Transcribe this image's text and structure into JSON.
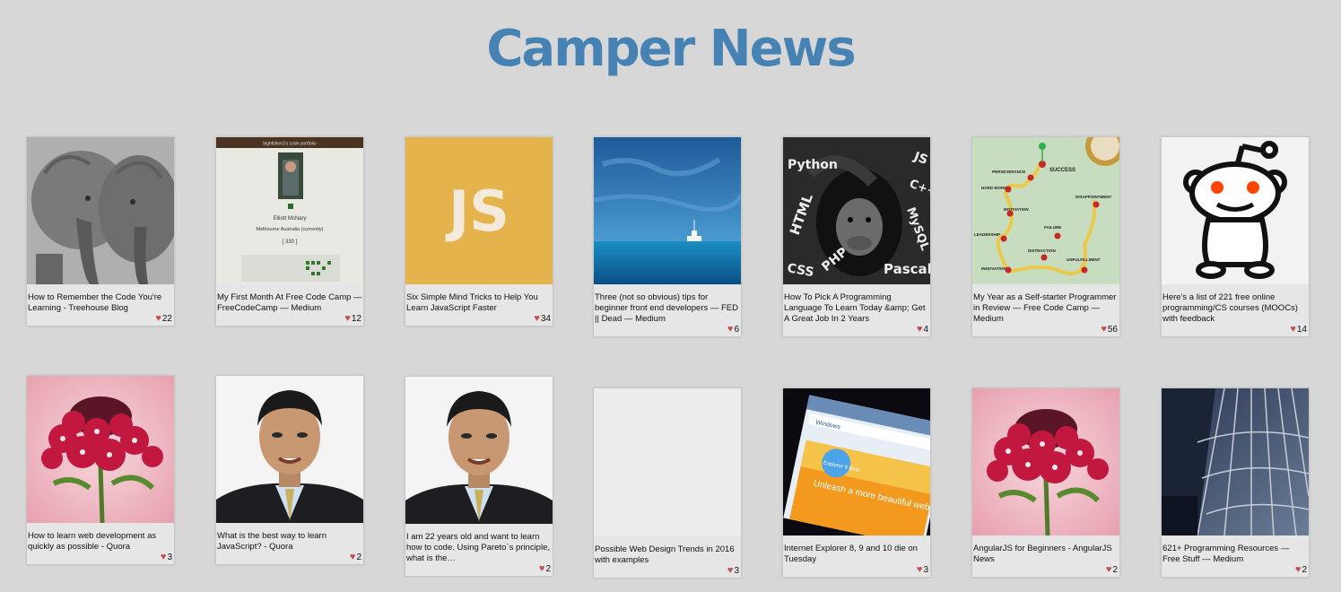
{
  "app": {
    "title": "Camper News"
  },
  "posts": [
    {
      "headline": "How to Remember the Code You're Learning - Treehouse Blog",
      "likes": "22",
      "image": "elephants-photo"
    },
    {
      "headline": "My First Month At Free Code Camp — FreeCodeCamp — Medium",
      "likes": "12",
      "image": "portfolio-screenshot",
      "portfolio": {
        "header": "bightbiker3's code portfolio",
        "name": "Elliott McNary",
        "location": "Melbourne Australia (currently)",
        "score": "[ 330 ]"
      }
    },
    {
      "headline": "Six Simple Mind Tricks to Help You Learn JavaScript Faster",
      "likes": "34",
      "image": "js-logo",
      "logo_text": "JS"
    },
    {
      "headline": "Three (not so obvious) tips for beginner front end developers — FED || Dead — Medium",
      "likes": "6",
      "image": "ocean-boat-photo"
    },
    {
      "headline": "How To Pick A Programming Language To Learn Today &amp; Get A Great Job In 2 Years",
      "likes": "4",
      "image": "chimp-languages-photo",
      "words": [
        "Python",
        "JS",
        "HTML",
        "C++",
        "MySQL",
        "CSS",
        "PHP",
        "Pascal"
      ]
    },
    {
      "headline": "My Year as a Self-starter Programmer in Review — Free Code Camp — Medium",
      "likes": "56",
      "image": "success-map",
      "map_words": [
        "SUCCESS",
        "PERSEVERANCE",
        "HARD WORK",
        "MOTIVATION",
        "LEADERSHIP",
        "FAILURE",
        "DISAPPOINTMENT",
        "DISTRACTION",
        "UNFULFILLMENT",
        "INNOVATION"
      ]
    },
    {
      "headline": "Here's a list of 221 free online programming/CS courses (MOOCs) with feedback",
      "likes": "14",
      "image": "reddit-alien"
    },
    {
      "headline": "How to learn web development as quickly as possible - Quora",
      "likes": "3",
      "image": "flower-photo"
    },
    {
      "headline": "What is the best way to learn JavaScript? - Quora",
      "likes": "2",
      "image": "portrait-photo"
    },
    {
      "headline": "I am 22 years old and want to learn how to code. Using Pareto`s principle, what is the…",
      "likes": "2",
      "image": "portrait-photo"
    },
    {
      "headline": "Possible Web Design Trends in 2016 with examples",
      "likes": "3",
      "image": "blank"
    },
    {
      "headline": "Internet Explorer 8, 9 and 10 die on Tuesday",
      "likes": "3",
      "image": "ie-screen-photo",
      "ie_text": {
        "logo": "Windows",
        "badge": "Explorer 9 Beta",
        "tagline": "Unleash a more beautiful web"
      }
    },
    {
      "headline": "AngularJS for Beginners - AngularJS News",
      "likes": "2",
      "image": "flower-photo"
    },
    {
      "headline": "621+ Programming Resources — Free Stuff — Medium",
      "likes": "2",
      "image": "building-photo"
    }
  ],
  "colors": {
    "title": "#4682b4",
    "heart": "#c0504d",
    "background": "#d7d7d7",
    "card": "#e6e6e6"
  },
  "icons": {
    "like": "heart-icon"
  }
}
